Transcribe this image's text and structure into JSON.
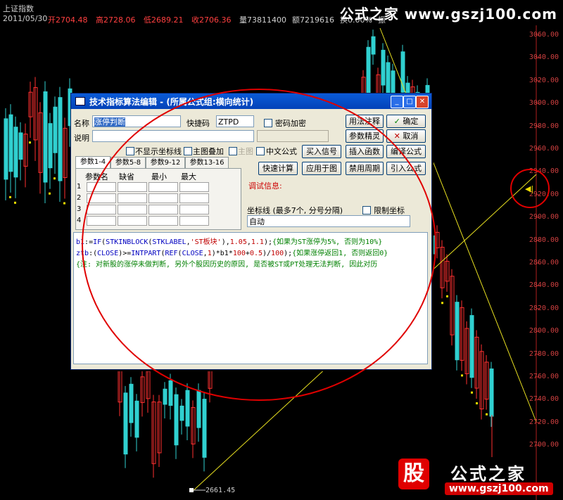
{
  "header": {
    "index_name": "上证指数",
    "date": "2011/05/30",
    "quotes": [
      {
        "text": "开2704.48",
        "color": "#ff4040"
      },
      {
        "text": "高2728.06",
        "color": "#ff4040"
      },
      {
        "text": "低2689.21",
        "color": "#ff4040"
      },
      {
        "text": "收2706.36",
        "color": "#ff4040"
      },
      {
        "text": "量73811400",
        "color": "#d0d0d0"
      },
      {
        "text": "额7219616",
        "color": "#d0d0d0"
      },
      {
        "text": "换0.00%",
        "color": "#d0d0d0"
      },
      {
        "text": "振",
        "color": "#d0d0d0"
      }
    ]
  },
  "watermark_top": "公式之家  www.gszj100.com",
  "watermark_bottom_cn": "公式之家",
  "watermark_bottom_url": "www.gszj100.com",
  "watermark_bottom_logo": "股",
  "y_axis": [
    "3060.00",
    "3040.00",
    "3020.00",
    "3000.00",
    "2980.00",
    "2960.00",
    "2940.00",
    "2920.00",
    "2900.00",
    "2880.00",
    "2860.00",
    "2840.00",
    "2820.00",
    "2800.00",
    "2780.00",
    "2760.00",
    "2740.00",
    "2720.00",
    "2700.00"
  ],
  "low_label": "2661.45",
  "dialog": {
    "title": "技术指标算法编辑 - (所属公式组:横向统计)",
    "name_label": "名称",
    "name_value": "涨停判断",
    "hotkey_label": "快捷码",
    "hotkey_value": "ZTPD",
    "password_label": "密码加密",
    "desc_label": "说明",
    "desc_value": "",
    "no_axis_label": "不显示坐标线",
    "overlay_label": "主图叠加",
    "main_label": "主图",
    "cn_formula_label": "中文公式",
    "tabs": [
      "参数1-4",
      "参数5-8",
      "参数9-12",
      "参数13-16"
    ],
    "grid_headers": [
      "参数名",
      "缺省",
      "最小",
      "最大"
    ],
    "grid_rows": [
      "1",
      "2",
      "3",
      "4"
    ],
    "debug_label": "调试信息:",
    "axis_lines_label": "坐标线 (最多7个, 分号分隔)",
    "limit_axis_label": "限制坐标",
    "axis_value": "自动",
    "buttons": {
      "usage": "用法注释",
      "ok": "确定",
      "param_wizard": "参数精灵",
      "cancel": "取消",
      "buy_sell": "买入信号",
      "insert_func": "插入函数",
      "compile": "编译公式",
      "quick_calc": "快速计算",
      "apply": "应用于图",
      "disable_period": "禁用周期",
      "import": "引入公式"
    },
    "code_lines": [
      [
        [
          "k",
          "b1"
        ],
        [
          "p",
          ":="
        ],
        [
          "k",
          "IF"
        ],
        [
          "p",
          "("
        ],
        [
          "k",
          "STKINBLOCK"
        ],
        [
          "p",
          "("
        ],
        [
          "k",
          "STKLABEL"
        ],
        [
          "p",
          ","
        ],
        [
          "s",
          "'ST板块'"
        ],
        [
          "p",
          "),"
        ],
        [
          "n",
          "1.05"
        ],
        [
          "p",
          ","
        ],
        [
          "n",
          "1.1"
        ],
        [
          "p",
          ");"
        ],
        [
          "c",
          "{如果为ST涨停为5%, 否则为10%}"
        ]
      ],
      [
        [
          "k",
          "ztb"
        ],
        [
          "p",
          ":("
        ],
        [
          "k",
          "CLOSE"
        ],
        [
          "p",
          ")>="
        ],
        [
          "k",
          "INTPART"
        ],
        [
          "p",
          "("
        ],
        [
          "k",
          "REF"
        ],
        [
          "p",
          "("
        ],
        [
          "k",
          "CLOSE"
        ],
        [
          "p",
          ","
        ],
        [
          "n",
          "1"
        ],
        [
          "p",
          ")*b1*"
        ],
        [
          "n",
          "100"
        ],
        [
          "p",
          "+"
        ],
        [
          "n",
          "0.5"
        ],
        [
          "p",
          ")/"
        ],
        [
          "n",
          "100"
        ],
        [
          "p",
          ");"
        ],
        [
          "c",
          "{如果涨停返回1, 否则返回0}"
        ]
      ],
      [
        [
          "c",
          "{注: 对新股的涨停未做判断, 另外个股因历史的原因, 是否被ST或PT处理无法判断, 因此对历"
        ]
      ]
    ]
  }
}
